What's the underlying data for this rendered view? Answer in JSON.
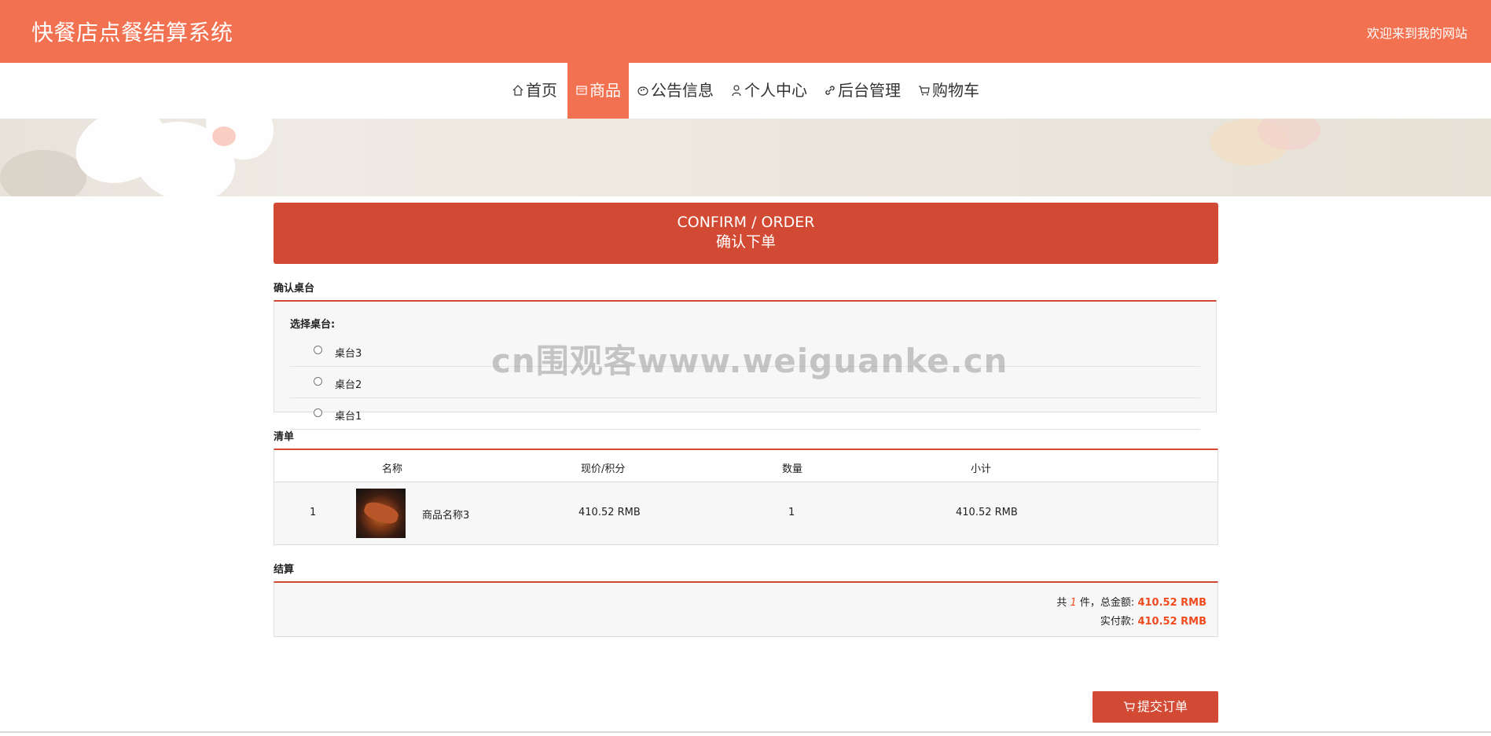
{
  "header": {
    "site_title": "快餐店点餐结算系统",
    "welcome_text": "欢迎来到我的网站"
  },
  "nav": {
    "items": [
      {
        "label": "首页",
        "icon": "home-icon",
        "active": false
      },
      {
        "label": "商品",
        "icon": "goods-icon",
        "active": true
      },
      {
        "label": "公告信息",
        "icon": "notice-icon",
        "active": false
      },
      {
        "label": "个人中心",
        "icon": "user-icon",
        "active": false
      },
      {
        "label": "后台管理",
        "icon": "link-icon",
        "active": false
      },
      {
        "label": "购物车",
        "icon": "cart-icon",
        "active": false
      }
    ]
  },
  "confirm": {
    "title_en": "CONFIRM / ORDER",
    "title_cn": "确认下单"
  },
  "table_section": {
    "title": "确认桌台",
    "select_label": "选择桌台:",
    "options": [
      "桌台3",
      "桌台2",
      "桌台1"
    ]
  },
  "list_section": {
    "title": "清单",
    "headers": [
      "名称",
      "现价/积分",
      "数量",
      "小计"
    ],
    "rows": [
      {
        "index": "1",
        "name": "商品名称3",
        "price": "410.52 RMB",
        "qty": "1",
        "subtotal": "410.52 RMB"
      }
    ]
  },
  "settle_section": {
    "title": "结算",
    "count_prefix": "共",
    "count": "1",
    "count_suffix": "件，总金额:",
    "total": "410.52 RMB",
    "paid_label": "实付款:",
    "paid": "410.52 RMB"
  },
  "submit_label": "提交订单",
  "watermark": "cn围观客www.weiguanke.cn",
  "colors": {
    "header_bg": "#f27150",
    "accent": "#d24a33",
    "price_red": "#ef4b1e"
  }
}
